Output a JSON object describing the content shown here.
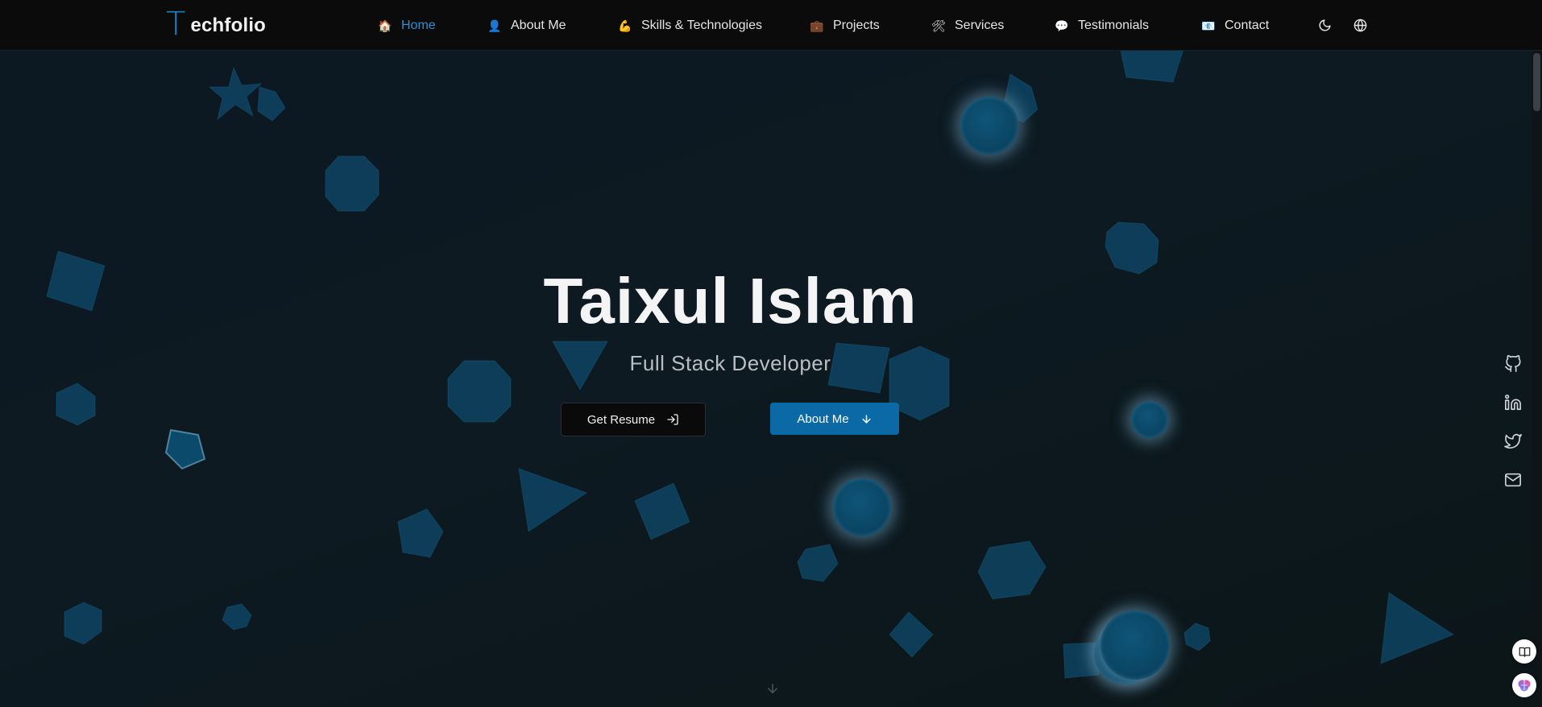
{
  "brand": {
    "logo_letter": "T",
    "name": "echfolio",
    "accent": "#1b83c5"
  },
  "nav": {
    "items": [
      {
        "emoji": "🏠",
        "label": "Home",
        "active": true
      },
      {
        "emoji": "👤",
        "label": "About Me"
      },
      {
        "emoji": "💪",
        "label": "Skills & Technologies"
      },
      {
        "emoji": "💼",
        "label": "Projects"
      },
      {
        "emoji": "🛠",
        "label": "Services"
      },
      {
        "emoji": "💬",
        "label": "Testimonials"
      },
      {
        "emoji": "📧",
        "label": "Contact"
      }
    ],
    "theme_icon": "moon-icon",
    "language_icon": "globe-icon"
  },
  "hero": {
    "name": "Taixul Islam",
    "role": "Full Stack Developer",
    "resume_button": "Get Resume",
    "about_button": "About Me"
  },
  "social": [
    "github-icon",
    "linkedin-icon",
    "twitter-icon",
    "mail-icon"
  ],
  "floating": [
    "book-icon",
    "brain-icon"
  ],
  "colors": {
    "primary_button": "#0b6aa6",
    "active_nav": "#2d8fd0",
    "shape": "#0e4a6b"
  }
}
